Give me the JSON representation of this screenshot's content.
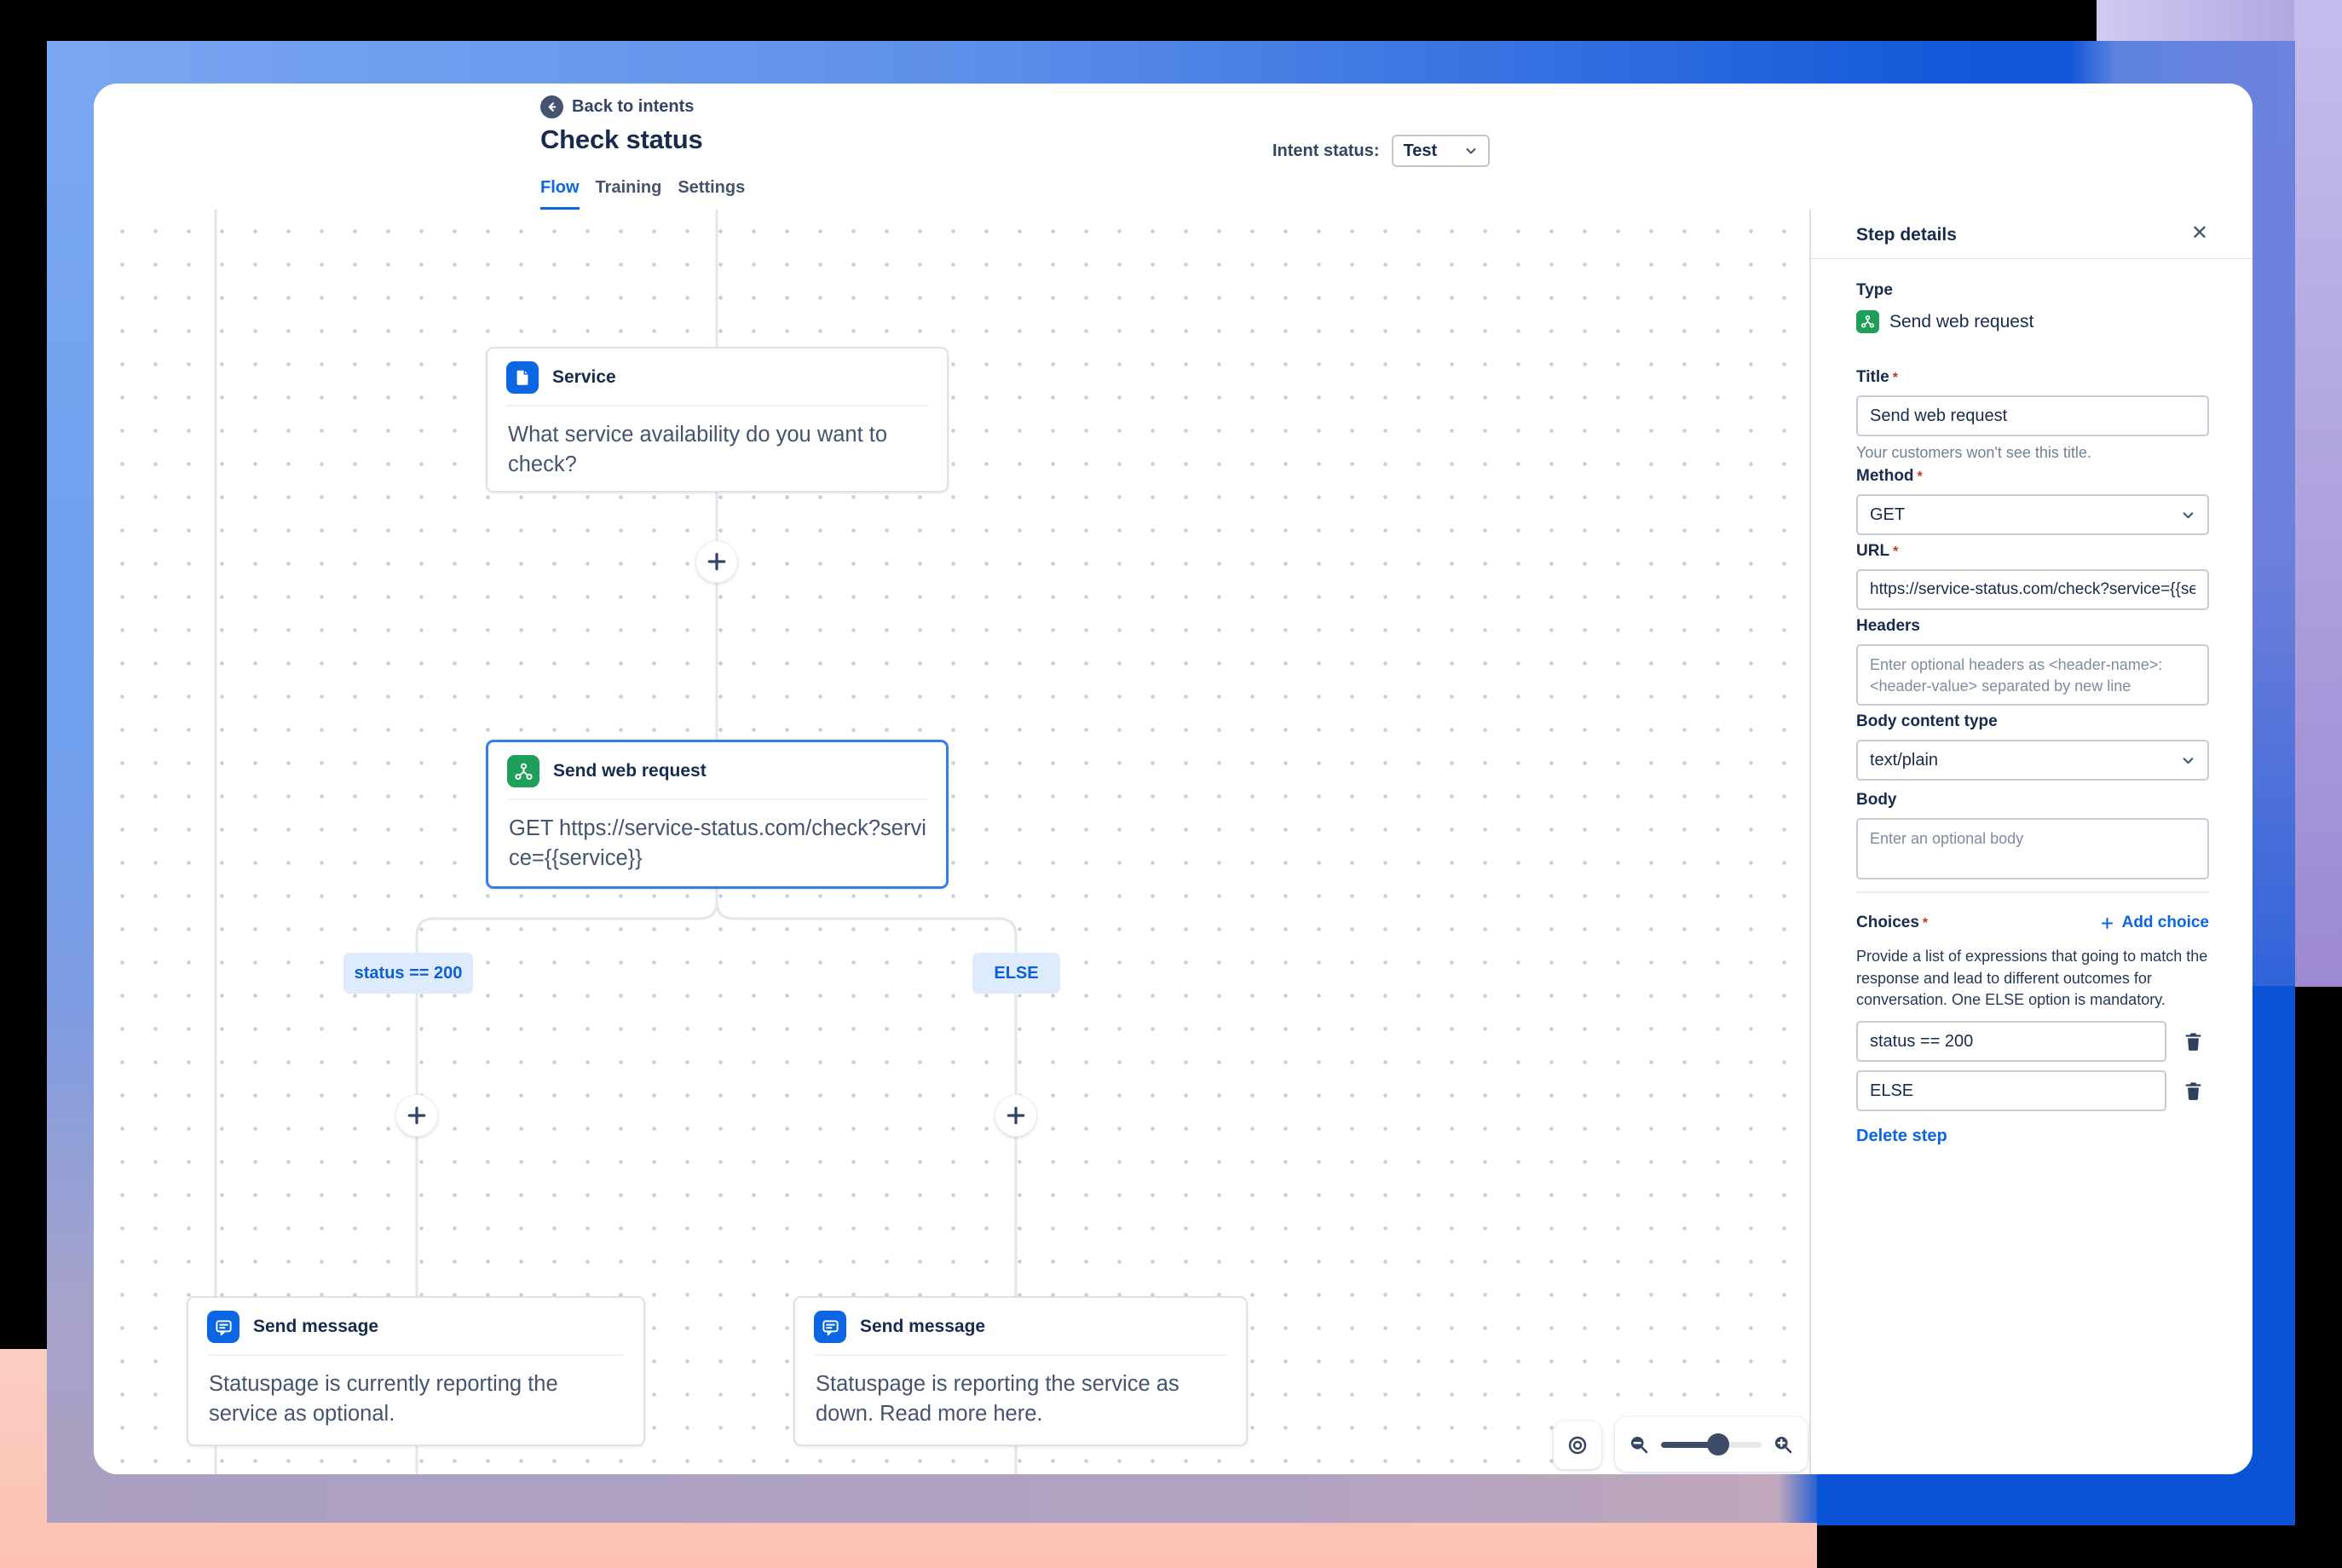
{
  "header": {
    "back_label": "Back to intents",
    "title": "Check status",
    "intent_status_label": "Intent status:",
    "intent_status_value": "Test",
    "tabs": [
      {
        "label": "Flow",
        "active": true
      },
      {
        "label": "Training",
        "active": false
      },
      {
        "label": "Settings",
        "active": false
      }
    ]
  },
  "flow": {
    "service_node": {
      "title": "Service",
      "body": "What service availability do you want to check?",
      "icon": "document-icon"
    },
    "web_request_node": {
      "title": "Send web request",
      "body": "GET https://service-status.com/check?service={{service}}",
      "icon": "webhook-icon",
      "selected": true
    },
    "branches": [
      "status == 200",
      "ELSE"
    ],
    "message_nodes": [
      {
        "title": "Send message",
        "body": "Statuspage is currently reporting the service as optional.",
        "icon": "chat-icon"
      },
      {
        "title": "Send message",
        "body": "Statuspage is reporting the service as down. Read more here.",
        "icon": "chat-icon"
      }
    ]
  },
  "zoom_controls": {
    "recenter_icon": "bullseye-icon",
    "zoom_out_icon": "magnifier-minus-icon",
    "zoom_in_icon": "magnifier-plus-icon",
    "slider_position_pct": 57
  },
  "panel": {
    "title": "Step details",
    "close_glyph": "✕",
    "required_marker": "*",
    "type": {
      "label": "Type",
      "value": "Send web request",
      "icon": "webhook-icon"
    },
    "title_field": {
      "label": "Title",
      "value": "Send web request",
      "helper": "Your customers won't see this title."
    },
    "method": {
      "label": "Method",
      "value": "GET"
    },
    "url": {
      "label": "URL",
      "value": "https://service-status.com/check?service={{service}}"
    },
    "headers": {
      "label": "Headers",
      "placeholder": "Enter optional headers as <header-name>: <header-value> separated by new line"
    },
    "body_content_type": {
      "label": "Body content type",
      "value": "text/plain"
    },
    "body": {
      "label": "Body",
      "placeholder": "Enter an optional body"
    },
    "choices": {
      "label": "Choices",
      "add_label": "Add choice",
      "description": "Provide a list of expressions that going to match the response and lead to different outcomes for conversation. One ELSE option is mandatory.",
      "items": [
        "status == 200",
        "ELSE"
      ]
    },
    "delete_label": "Delete step"
  },
  "colors": {
    "accent_blue": "#0C66E4",
    "node_green": "#1EA05B",
    "chip_bg": "#DEEBFC",
    "text_primary": "#172B4D",
    "text_secondary": "#44546F",
    "frame_blue": "#1157D7",
    "frame_purple": "#9C89D2",
    "frame_salmon": "#FBCEC1",
    "bottom_right_blue": "#0B53D6"
  }
}
